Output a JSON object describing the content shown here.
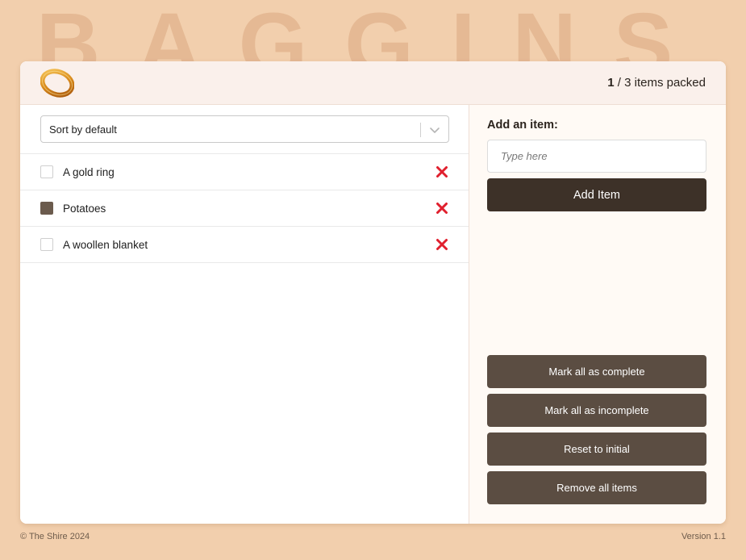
{
  "background_title": "BAGGINS",
  "header": {
    "logo_icon": "gold-ring-icon",
    "packed_count": "1",
    "counter_text": " / 3 items packed"
  },
  "sort": {
    "selected": "Sort by default"
  },
  "items": [
    {
      "label": "A gold ring",
      "packed": false
    },
    {
      "label": "Potatoes",
      "packed": true
    },
    {
      "label": "A woollen blanket",
      "packed": false
    }
  ],
  "add_form": {
    "title": "Add an item:",
    "placeholder": "Type here",
    "button_label": "Add Item"
  },
  "actions": {
    "mark_complete": "Mark all as complete",
    "mark_incomplete": "Mark all as incomplete",
    "reset": "Reset to initial",
    "remove_all": "Remove all items"
  },
  "footer": {
    "copyright": "© The Shire 2024",
    "version": "Version 1.1"
  },
  "colors": {
    "page_background": "#f2cfad",
    "header_background": "#faf0eb",
    "primary_button": "#3d3128",
    "secondary_button": "#5b4d42",
    "delete_icon": "#e0202e",
    "checked_box": "#6b5b4d"
  }
}
